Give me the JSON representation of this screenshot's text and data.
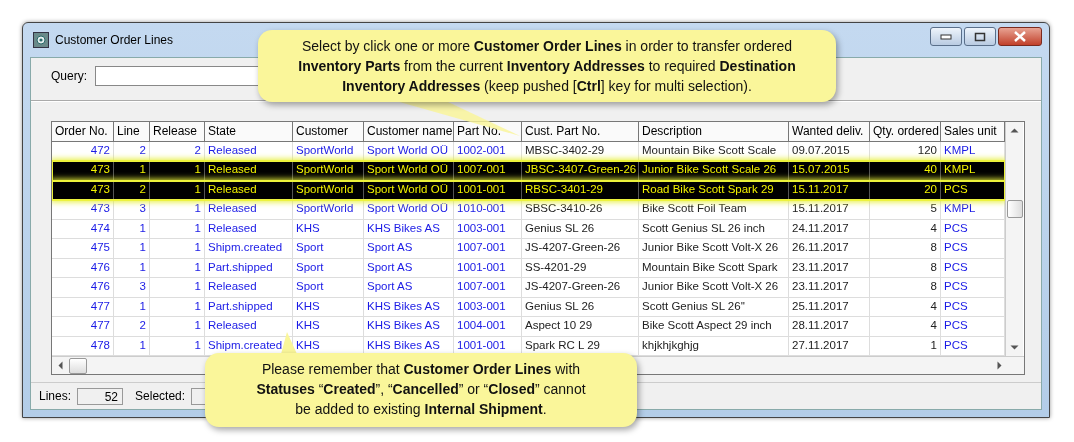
{
  "window": {
    "title": "Customer Order Lines"
  },
  "query": {
    "label": "Query:"
  },
  "table": {
    "columns": [
      "Order No.",
      "Line",
      "Release",
      "State",
      "Customer",
      "Customer name",
      "Part No.",
      "Cust. Part No.",
      "Description",
      "Wanted deliv.",
      "Qty. ordered",
      "Sales unit"
    ],
    "rows": [
      {
        "selected": false,
        "cells": [
          "472",
          "2",
          "2",
          "Released",
          "SportWorld",
          "Sport World OÜ",
          "1002-001",
          "MBSC-3402-29",
          "Mountain Bike Scott Scale",
          "09.07.2015",
          "120",
          "KMPL"
        ]
      },
      {
        "selected": true,
        "cells": [
          "473",
          "1",
          "1",
          "Released",
          "SportWorld",
          "Sport World OÜ",
          "1007-001",
          "JBSC-3407-Green-26",
          "Junior Bike Scott Scale 26",
          "15.07.2015",
          "40",
          "KMPL"
        ]
      },
      {
        "selected": true,
        "cells": [
          "473",
          "2",
          "1",
          "Released",
          "SportWorld",
          "Sport World OÜ",
          "1001-001",
          "RBSC-3401-29",
          "Road Bike Scott Spark 29",
          "15.11.2017",
          "20",
          "PCS"
        ]
      },
      {
        "selected": false,
        "cells": [
          "473",
          "3",
          "1",
          "Released",
          "SportWorld",
          "Sport World OÜ",
          "1010-001",
          "SBSC-3410-26",
          "Bike Scott Foil Team",
          "15.11.2017",
          "5",
          "KMPL"
        ]
      },
      {
        "selected": false,
        "cells": [
          "474",
          "1",
          "1",
          "Released",
          "KHS",
          "KHS Bikes AS",
          "1003-001",
          "Genius SL 26",
          "Scott Genius SL 26 inch",
          "24.11.2017",
          "4",
          "PCS"
        ]
      },
      {
        "selected": false,
        "cells": [
          "475",
          "1",
          "1",
          "Shipm.created",
          "Sport",
          "Sport AS",
          "1007-001",
          "JS-4207-Green-26",
          "Junior Bike Scott Volt-X 26",
          "26.11.2017",
          "8",
          "PCS"
        ]
      },
      {
        "selected": false,
        "cells": [
          "476",
          "1",
          "1",
          "Part.shipped",
          "Sport",
          "Sport AS",
          "1001-001",
          "SS-4201-29",
          "Mountain Bike Scott Spark",
          "23.11.2017",
          "8",
          "PCS"
        ]
      },
      {
        "selected": false,
        "cells": [
          "476",
          "3",
          "1",
          "Released",
          "Sport",
          "Sport AS",
          "1007-001",
          "JS-4207-Green-26",
          "Junior Bike Scott Volt-X 26",
          "23.11.2017",
          "8",
          "PCS"
        ]
      },
      {
        "selected": false,
        "cells": [
          "477",
          "1",
          "1",
          "Part.shipped",
          "KHS",
          "KHS Bikes AS",
          "1003-001",
          "Genius SL 26",
          "Scott Genius SL 26''",
          "25.11.2017",
          "4",
          "PCS"
        ]
      },
      {
        "selected": false,
        "cells": [
          "477",
          "2",
          "1",
          "Released",
          "KHS",
          "KHS Bikes AS",
          "1004-001",
          "Aspect 10 29",
          "Bike Scott Aspect 29 inch",
          "28.11.2017",
          "4",
          "PCS"
        ]
      },
      {
        "selected": false,
        "cells": [
          "478",
          "1",
          "1",
          "Shipm.created",
          "KHS",
          "KHS Bikes AS",
          "1001-001",
          "Spark RC L 29",
          "khjkhjkghjg",
          "27.11.2017",
          "1",
          "PCS"
        ]
      }
    ]
  },
  "status_bar": {
    "lines_label": "Lines:",
    "lines_value": "52",
    "selected_label": "Selected:"
  },
  "callouts": [
    {
      "text": "Select by click one or more **Customer Order Lines** in order to transfer ordered **Inventory Parts** from the current **Inventory Addresses** to required **Destination Inventory Addresses** (keep pushed [**Ctrl**] key for multi selection)."
    },
    {
      "text": "Please remember that **Customer Order Lines** with **Statuses** “**Created**”, “**Cancelled**” or “**Closed**” cannot be added to existing **Internal Shipment**."
    }
  ]
}
